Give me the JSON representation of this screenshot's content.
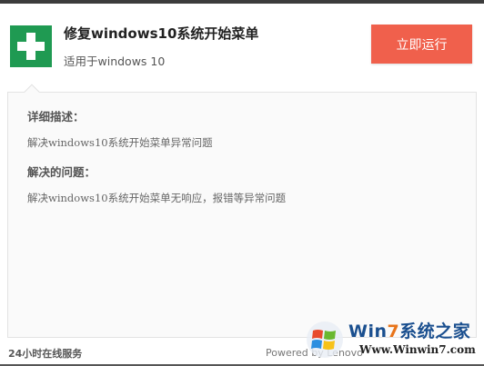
{
  "app": {
    "title": "修复windows10系统开始菜单",
    "subtitle": "适用于windows 10",
    "run_label": "立即运行"
  },
  "icons": {
    "app": "first-aid-cross-icon",
    "watermark": "windows-flag-icon"
  },
  "details": {
    "desc_title": "详细描述：",
    "desc_text": "解决windows10系统开始菜单异常问题",
    "problem_title": "解决的问题：",
    "problem_text": "解决windows10系统开始菜单无响应，报错等异常问题"
  },
  "footer": {
    "service": "24小时在线服务",
    "powered": "Powered by Lenovo"
  },
  "watermark": {
    "brand_prefix": "Win",
    "brand_seven": "7",
    "brand_suffix": "系统之家",
    "url": "Www.Winwin7.com"
  },
  "colors": {
    "accent": "#f0604c",
    "icon_green": "#1f9a52",
    "brand_blue": "#1a4f8f",
    "brand_orange": "#e8741a"
  }
}
